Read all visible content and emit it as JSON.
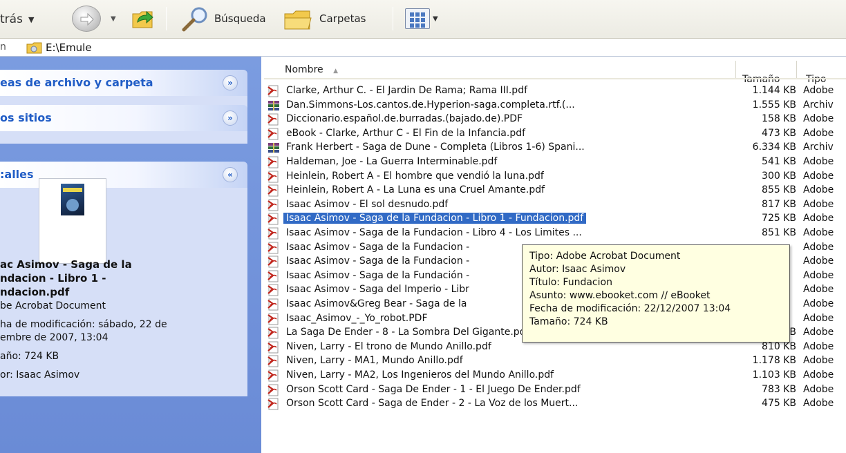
{
  "toolbar": {
    "back_label": "trás",
    "search_label": "Búsqueda",
    "folders_label": "Carpetas"
  },
  "address": {
    "path": "E:\\Emule"
  },
  "taskpane": {
    "tasks_title": "eas de archivo y carpeta",
    "places_title": "os sitios",
    "details_title": ":alles",
    "details": {
      "name_line1": "ac Asimov - Saga de la",
      "name_line2": "ndacion - Libro 1 -",
      "name_line3": "ndacion.pdf",
      "type": "be Acrobat Document",
      "modified_line1": "ha de modificación: sábado, 22 de",
      "modified_line2": "embre de 2007, 13:04",
      "size": "año: 724 KB",
      "author": "or: Isaac Asimov"
    }
  },
  "columns": {
    "name": "Nombre",
    "size": "Tamaño",
    "type": "Tipo"
  },
  "files": [
    {
      "name": "Clarke, Arthur C. - El Jardin De Rama; Rama III.pdf",
      "size": "1.144 KB",
      "type": "Adobe",
      "icon": "pdf-icon"
    },
    {
      "name": "Dan.Simmons-Los.cantos.de.Hyperion-saga.completa.rtf.(...",
      "size": "1.555 KB",
      "type": "Archiv",
      "icon": "archive-icon"
    },
    {
      "name": "Diccionario.español.de.burradas.(bajado.de).PDF",
      "size": "158 KB",
      "type": "Adobe",
      "icon": "pdf-icon"
    },
    {
      "name": "eBook - Clarke, Arthur C - El Fin de la Infancia.pdf",
      "size": "473 KB",
      "type": "Adobe",
      "icon": "pdf-icon"
    },
    {
      "name": "Frank Herbert - Saga de Dune - Completa (Libros 1-6) Spani...",
      "size": "6.334 KB",
      "type": "Archiv",
      "icon": "archive-icon"
    },
    {
      "name": "Haldeman, Joe - La Guerra Interminable.pdf",
      "size": "541 KB",
      "type": "Adobe",
      "icon": "pdf-icon"
    },
    {
      "name": "Heinlein, Robert A - El hombre que vendió la luna.pdf",
      "size": "300 KB",
      "type": "Adobe",
      "icon": "pdf-icon"
    },
    {
      "name": "Heinlein, Robert A - La Luna es una Cruel Amante.pdf",
      "size": "855 KB",
      "type": "Adobe",
      "icon": "pdf-icon"
    },
    {
      "name": "Isaac Asimov - El sol desnudo.pdf",
      "size": "817 KB",
      "type": "Adobe",
      "icon": "pdf-icon"
    },
    {
      "name": "Isaac Asimov - Saga de la Fundacion - Libro 1 - Fundacion.pdf",
      "size": "725 KB",
      "type": "Adobe",
      "icon": "pdf-icon",
      "selected": true
    },
    {
      "name": "Isaac Asimov - Saga de la Fundacion - Libro 4 - Los Limites ...",
      "size": "851 KB",
      "type": "Adobe",
      "icon": "pdf-icon"
    },
    {
      "name": "Isaac Asimov - Saga de la Fundacion -",
      "size": "",
      "type": "Adobe",
      "icon": "pdf-icon"
    },
    {
      "name": "Isaac Asimov - Saga de la Fundacion -",
      "size": "",
      "type": "Adobe",
      "icon": "pdf-icon"
    },
    {
      "name": "Isaac Asimov - Saga de la Fundación -",
      "size": "",
      "type": "Adobe",
      "icon": "pdf-icon"
    },
    {
      "name": "Isaac Asimov - Saga del Imperio - Libr",
      "size": "",
      "type": "Adobe",
      "icon": "pdf-icon"
    },
    {
      "name": "Isaac Asimov&Greg Bear - Saga de la",
      "size": "",
      "type": "Adobe",
      "icon": "pdf-icon"
    },
    {
      "name": "Isaac_Asimov_-_Yo_robot.PDF",
      "size": "",
      "type": "Adobe",
      "icon": "pdf-icon"
    },
    {
      "name": "La Saga De Ender - 8 - La Sombra Del Gigante.pdf",
      "size": "1.558 KB",
      "type": "Adobe",
      "icon": "pdf-icon"
    },
    {
      "name": "Niven, Larry - El trono de Mundo Anillo.pdf",
      "size": "810 KB",
      "type": "Adobe",
      "icon": "pdf-icon"
    },
    {
      "name": "Niven, Larry - MA1, Mundo Anillo.pdf",
      "size": "1.178 KB",
      "type": "Adobe",
      "icon": "pdf-icon"
    },
    {
      "name": "Niven, Larry - MA2, Los Ingenieros del Mundo Anillo.pdf",
      "size": "1.103 KB",
      "type": "Adobe",
      "icon": "pdf-icon"
    },
    {
      "name": "Orson Scott Card - Saga De Ender - 1 - El Juego De Ender.pdf",
      "size": "783 KB",
      "type": "Adobe",
      "icon": "pdf-icon"
    },
    {
      "name": "Orson Scott Card - Saga de Ender - 2 - La Voz de los Muert...",
      "size": "475 KB",
      "type": "Adobe",
      "icon": "pdf-icon"
    }
  ],
  "tooltip": {
    "type": "Tipo: Adobe Acrobat Document",
    "author": "Autor: Isaac Asimov",
    "title": "Título: Fundacion",
    "subject": "Asunto: www.ebooket.com // eBooket",
    "modified": "Fecha de modificación: 22/12/2007 13:04",
    "size": "Tamaño: 724 KB"
  },
  "colors": {
    "selection": "#316ac5",
    "taskpane_bg": "#6a8bd6",
    "panel_header_text": "#215dc6",
    "tooltip_bg": "#ffffe1"
  }
}
